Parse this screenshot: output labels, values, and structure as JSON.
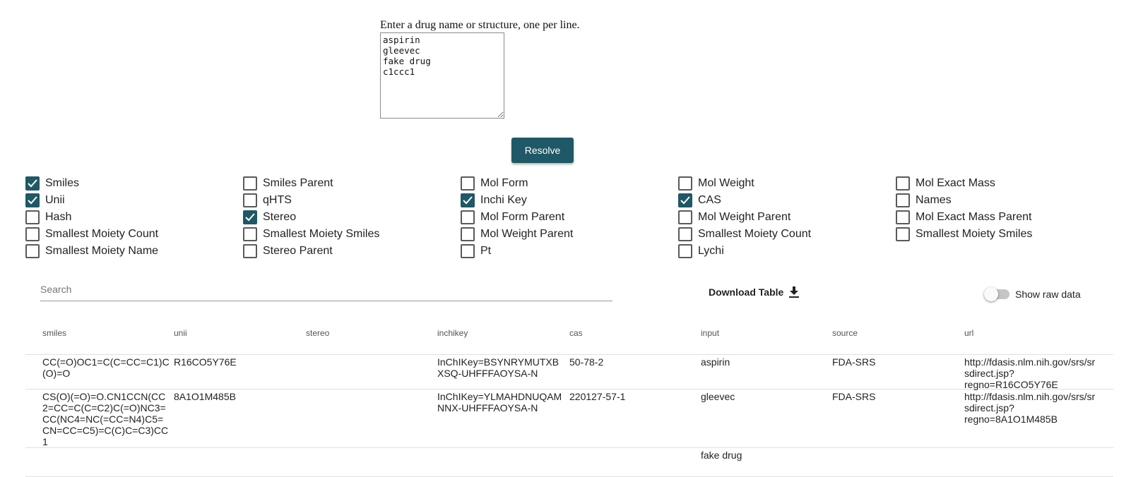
{
  "resolver": {
    "prompt": "Enter a drug name or structure, one per line.",
    "textarea_value": "aspirin\ngleevec\nfake drug\nc1ccc1",
    "resolve_label": "Resolve"
  },
  "options": [
    [
      {
        "label": "Smiles",
        "checked": true
      },
      {
        "label": "Smiles Parent",
        "checked": false
      },
      {
        "label": "Mol Form",
        "checked": false
      },
      {
        "label": "Mol Weight",
        "checked": false
      },
      {
        "label": "Mol Exact Mass",
        "checked": false
      }
    ],
    [
      {
        "label": "Unii",
        "checked": true
      },
      {
        "label": "qHTS",
        "checked": false
      },
      {
        "label": "Inchi Key",
        "checked": true
      },
      {
        "label": "CAS",
        "checked": true
      },
      {
        "label": "Names",
        "checked": false
      }
    ],
    [
      {
        "label": "Hash",
        "checked": false
      },
      {
        "label": "Stereo",
        "checked": true
      },
      {
        "label": "Mol Form Parent",
        "checked": false
      },
      {
        "label": "Mol Weight Parent",
        "checked": false
      },
      {
        "label": "Mol Exact Mass Parent",
        "checked": false
      }
    ],
    [
      {
        "label": "Smallest Moiety Count",
        "checked": false
      },
      {
        "label": "Smallest Moiety Smiles",
        "checked": false
      },
      {
        "label": "Mol Weight Parent",
        "checked": false
      },
      {
        "label": "Smallest Moiety Count",
        "checked": false
      },
      {
        "label": "Smallest Moiety Smiles",
        "checked": false
      }
    ],
    [
      {
        "label": "Smallest Moiety Name",
        "checked": false
      },
      {
        "label": "Stereo Parent",
        "checked": false
      },
      {
        "label": "Pt",
        "checked": false
      },
      {
        "label": "Lychi",
        "checked": false
      }
    ]
  ],
  "search": {
    "placeholder": "Search"
  },
  "download": {
    "label": "Download Table",
    "icon": "download-icon"
  },
  "raw_toggle": {
    "label": "Show raw data",
    "on": false
  },
  "table": {
    "columns": [
      "smiles",
      "unii",
      "stereo",
      "inchikey",
      "cas",
      "input",
      "source",
      "url"
    ],
    "rows": [
      {
        "smiles": "CC(=O)OC1=C(C=CC=C1)C(O)=O",
        "unii": "R16CO5Y76E",
        "stereo": "",
        "inchikey": "InChIKey=BSYNRYMUTXBXSQ-UHFFFAOYSA-N",
        "cas": "50-78-2",
        "input": "aspirin",
        "source": "FDA-SRS",
        "url": "http://fdasis.nlm.nih.gov/srs/srsdirect.jsp?regno=R16CO5Y76E"
      },
      {
        "smiles": "CS(O)(=O)=O.CN1CCN(CC2=CC=C(C=C2)C(=O)NC3=CC(NC4=NC(=CC=N4)C5=CN=CC=C5)=C(C)C=C3)CC1",
        "unii": "8A1O1M485B",
        "stereo": "",
        "inchikey": "InChIKey=YLMAHDNUQAMNNX-UHFFFAOYSA-N",
        "cas": "220127-57-1",
        "input": "gleevec",
        "source": "FDA-SRS",
        "url": "http://fdasis.nlm.nih.gov/srs/srsdirect.jsp?regno=8A1O1M485B"
      },
      {
        "smiles": "",
        "unii": "",
        "stereo": "",
        "inchikey": "",
        "cas": "",
        "input": "fake drug",
        "source": "",
        "url": ""
      }
    ]
  }
}
